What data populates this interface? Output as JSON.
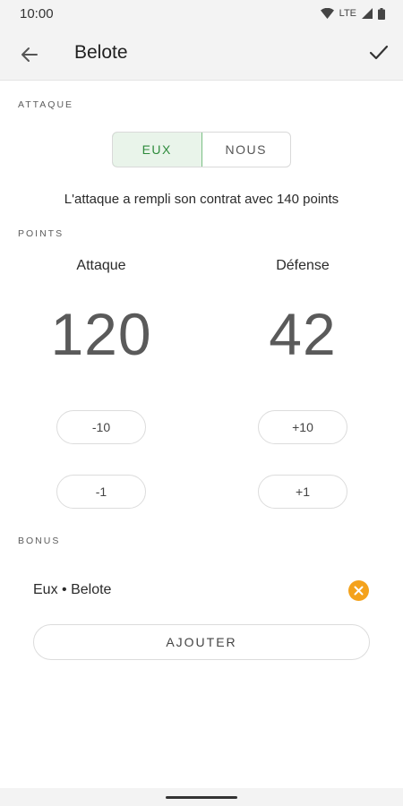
{
  "status_bar": {
    "time": "10:00",
    "network": "LTE"
  },
  "app_bar": {
    "title": "Belote"
  },
  "attack_section": {
    "label": "ATTAQUE",
    "options": [
      "EUX",
      "NOUS"
    ],
    "selected": "EUX",
    "result_text": "L'attaque a rempli son contrat avec 140 points"
  },
  "points_section": {
    "label": "POINTS",
    "attack": {
      "title": "Attaque",
      "score": "120",
      "minus10": "-10",
      "minus1": "-1"
    },
    "defense": {
      "title": "Défense",
      "score": "42",
      "plus10": "+10",
      "plus1": "+1"
    }
  },
  "bonus_section": {
    "label": "BONUS",
    "items": [
      {
        "text": "Eux • Belote"
      }
    ],
    "add_label": "AJOUTER"
  },
  "colors": {
    "accent_green": "#2e8b3c",
    "remove_orange": "#f4a21c"
  }
}
